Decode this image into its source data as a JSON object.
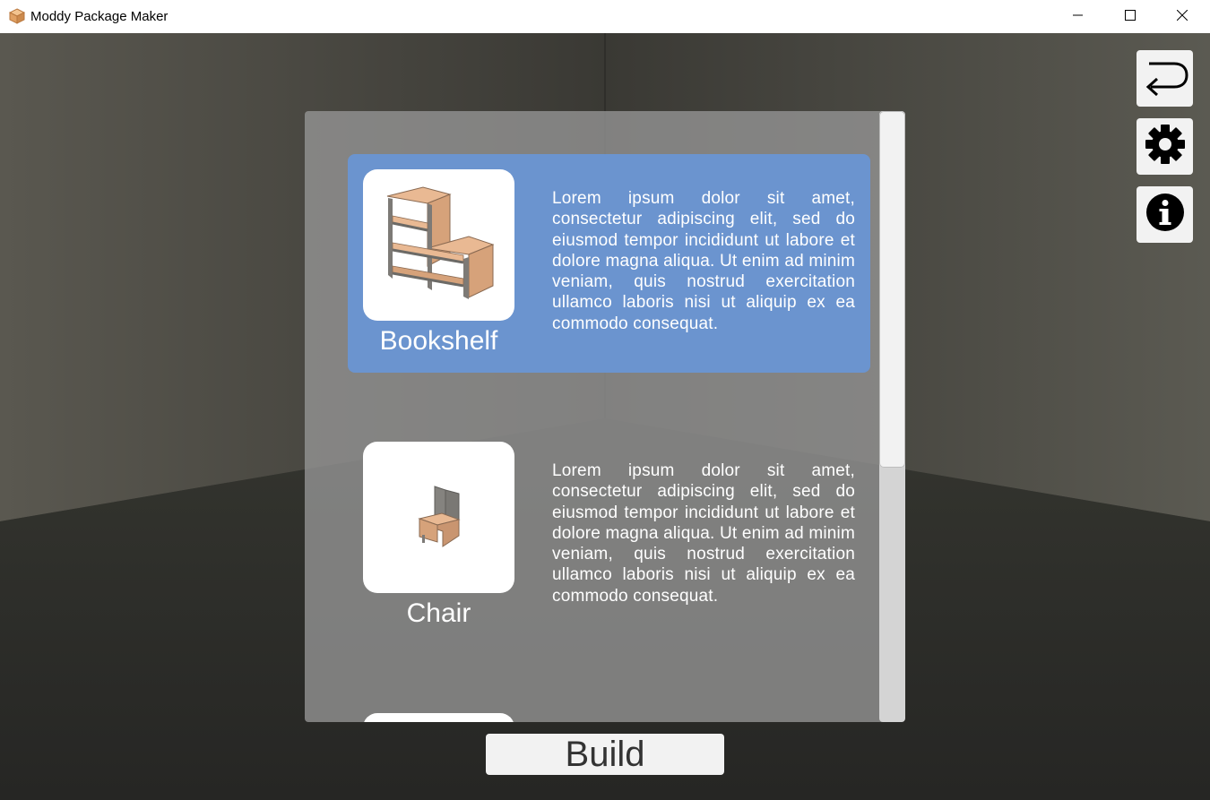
{
  "window": {
    "title": "Moddy Package Maker",
    "app_icon": "package-box-icon",
    "controls": [
      "minimize-icon",
      "maximize-icon",
      "close-icon"
    ]
  },
  "toolbar": {
    "back_icon": "return-arrow-icon",
    "settings_icon": "gear-icon",
    "info_icon": "info-icon"
  },
  "items": [
    {
      "name": "Bookshelf",
      "thumbnail": "bookshelf-model",
      "selected": true,
      "description": "Lorem ipsum dolor sit amet, consectetur adipiscing elit, sed do eiusmod tempor incididunt ut labore et dolore magna aliqua. Ut enim ad minim veniam, quis nostrud exercitation ullamco laboris nisi ut aliquip ex ea commodo consequat."
    },
    {
      "name": "Chair",
      "thumbnail": "chair-model",
      "selected": false,
      "description": "Lorem ipsum dolor sit amet, consectetur adipiscing elit, sed do eiusmod tempor incididunt ut labore et dolore magna aliqua. Ut enim ad minim veniam, quis nostrud exercitation ullamco laboris nisi ut aliquip ex ea commodo consequat."
    }
  ],
  "build_label": "Build",
  "colors": {
    "selected_item": "#6b94cf",
    "panel": "#969696",
    "wood": "#d9a27a"
  }
}
